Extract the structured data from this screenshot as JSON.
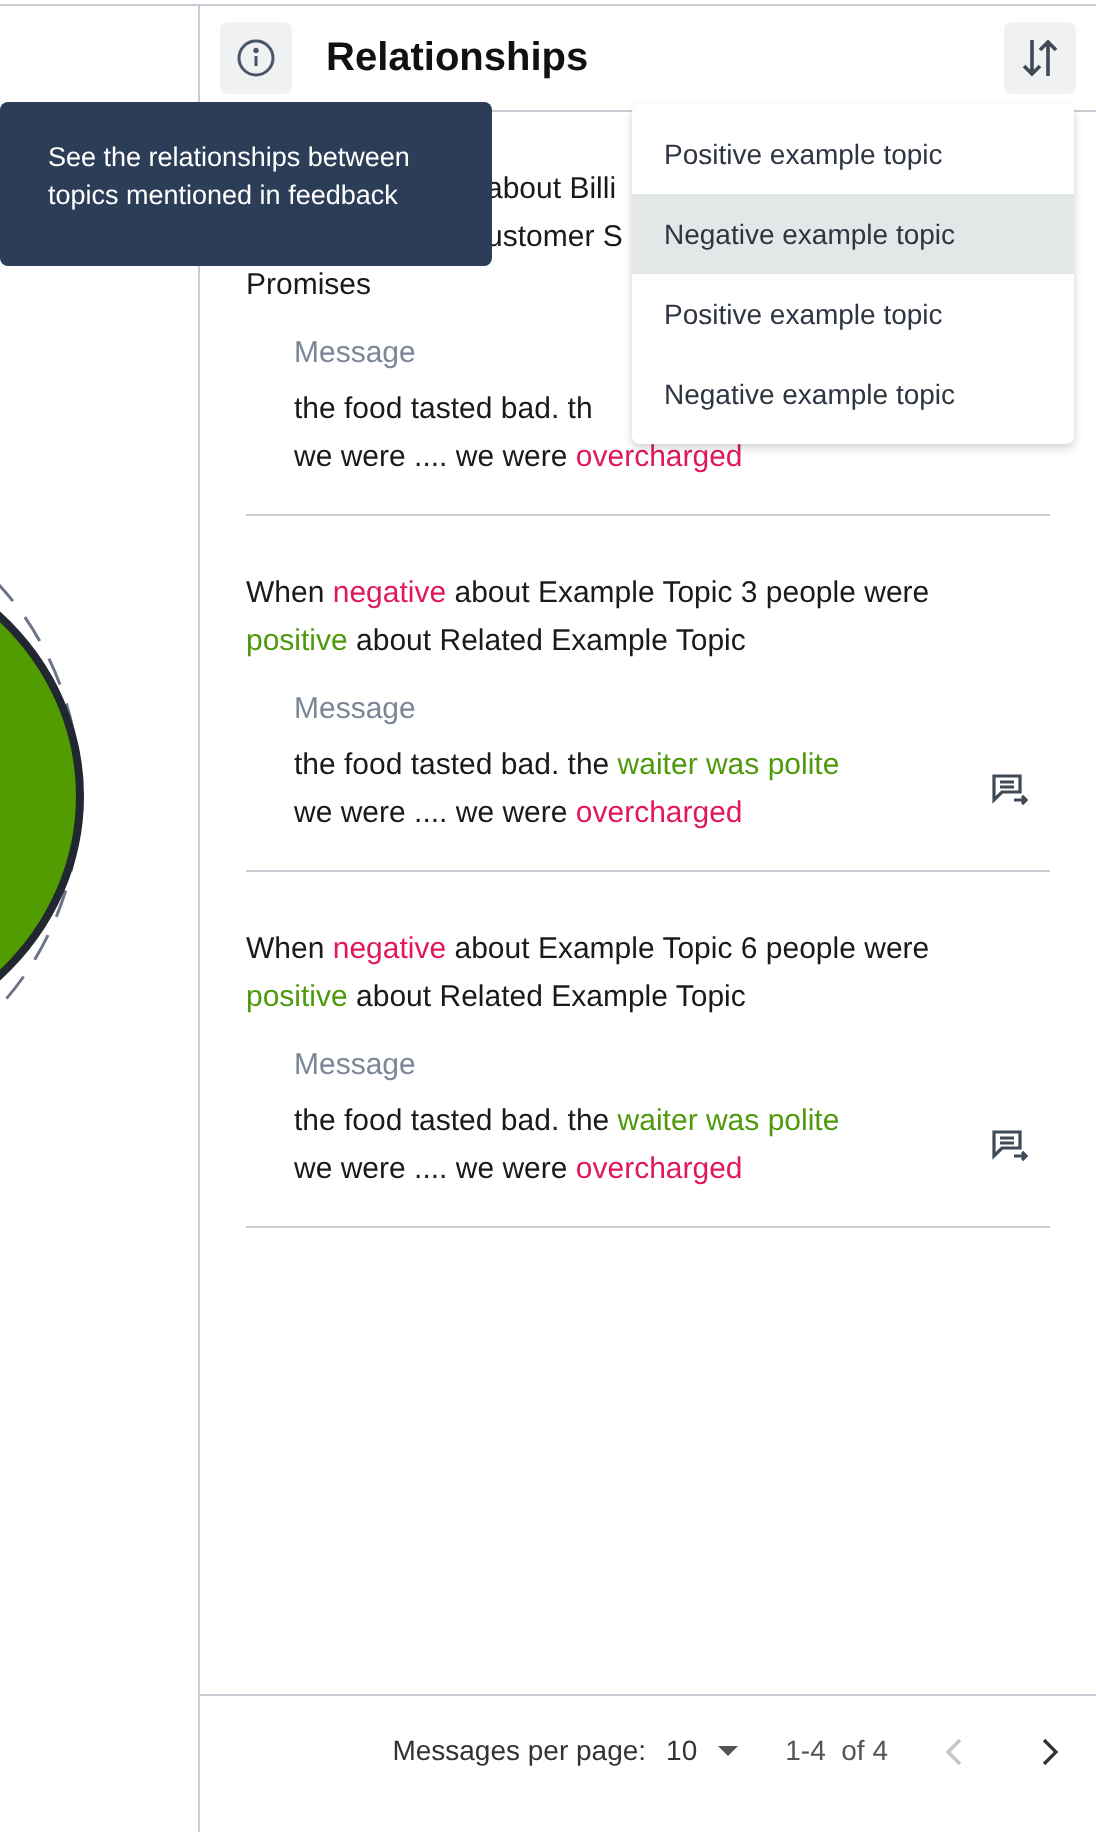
{
  "panel": {
    "title": "Relationships"
  },
  "tooltip": {
    "text": "See the relationships between topics mentioned in feedback"
  },
  "sort_menu": [
    {
      "label": "Positive example topic",
      "selected": false
    },
    {
      "label": "Negative example topic",
      "selected": true
    },
    {
      "label": "Positive example topic",
      "selected": false
    },
    {
      "label": "Negative example topic",
      "selected": false
    }
  ],
  "relationships": [
    {
      "sentence": [
        [
          {
            "text": "about Billi",
            "kind": "plain"
          }
        ],
        [
          {
            "text": "ustomer S",
            "kind": "plain"
          }
        ],
        [
          {
            "text": "Promises",
            "kind": "plain"
          }
        ]
      ],
      "message_label": "Message",
      "message": [
        [
          {
            "text": "the food tasted bad. th",
            "kind": "plain"
          }
        ],
        [
          {
            "text": "we were .... we were ",
            "kind": "plain"
          },
          {
            "text": "overcharged",
            "kind": "negative"
          }
        ]
      ]
    },
    {
      "sentence": [
        [
          {
            "text": "When ",
            "kind": "plain"
          },
          {
            "text": "negative",
            "kind": "negative"
          },
          {
            "text": " about Example Topic 3 people were",
            "kind": "plain"
          }
        ],
        [
          {
            "text": "positive",
            "kind": "positive"
          },
          {
            "text": " about Related Example Topic",
            "kind": "plain"
          }
        ]
      ],
      "message_label": "Message",
      "message": [
        [
          {
            "text": "the food tasted bad. the ",
            "kind": "plain"
          },
          {
            "text": "waiter was polite",
            "kind": "positive"
          }
        ],
        [
          {
            "text": "we were .... we were ",
            "kind": "plain"
          },
          {
            "text": "overcharged",
            "kind": "negative"
          }
        ]
      ],
      "action_visible": true
    },
    {
      "sentence": [
        [
          {
            "text": "When ",
            "kind": "plain"
          },
          {
            "text": "negative",
            "kind": "negative"
          },
          {
            "text": " about Example Topic 6 people were",
            "kind": "plain"
          }
        ],
        [
          {
            "text": "positive",
            "kind": "positive"
          },
          {
            "text": " about Related Example Topic",
            "kind": "plain"
          }
        ]
      ],
      "message_label": "Message",
      "message": [
        [
          {
            "text": "the food tasted bad. the ",
            "kind": "plain"
          },
          {
            "text": "waiter was polite",
            "kind": "positive"
          }
        ],
        [
          {
            "text": "we were .... we were ",
            "kind": "plain"
          },
          {
            "text": "overcharged",
            "kind": "negative"
          }
        ]
      ],
      "action_visible": true
    }
  ],
  "pagination": {
    "label": "Messages per page:",
    "per_page": "10",
    "range": "1-4  of 4",
    "prev_disabled": true,
    "next_disabled": false
  }
}
